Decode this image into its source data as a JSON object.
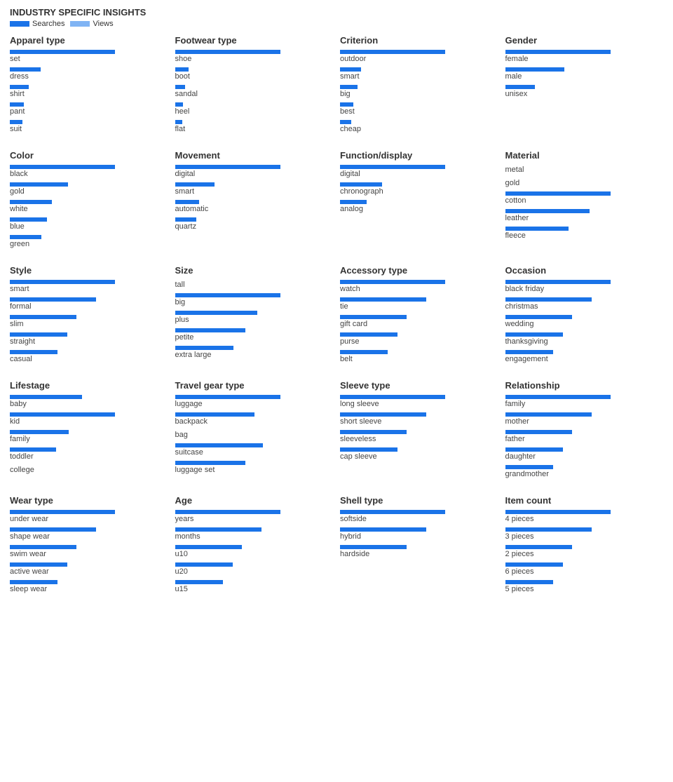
{
  "header": {
    "title": "INDUSTRY SPECIFIC INSIGHTS",
    "searches_label": "Searches",
    "views_label": "Views"
  },
  "sections": [
    {
      "id": "apparel-type",
      "title": "Apparel type",
      "items": [
        {
          "label": "set",
          "s": 120,
          "v": 0
        },
        {
          "label": "dress",
          "s": 35,
          "v": 0
        },
        {
          "label": "shirt",
          "s": 22,
          "v": 0
        },
        {
          "label": "pant",
          "s": 16,
          "v": 0
        },
        {
          "label": "suit",
          "s": 14,
          "v": 0
        }
      ]
    },
    {
      "id": "footwear-type",
      "title": "Footwear type",
      "items": [
        {
          "label": "shoe",
          "s": 170,
          "v": 0
        },
        {
          "label": "boot",
          "s": 22,
          "v": 0
        },
        {
          "label": "sandal",
          "s": 16,
          "v": 0
        },
        {
          "label": "heel",
          "s": 13,
          "v": 0
        },
        {
          "label": "flat",
          "s": 11,
          "v": 0
        }
      ]
    },
    {
      "id": "criterion",
      "title": "Criterion",
      "items": [
        {
          "label": "outdoor",
          "s": 110,
          "v": 0
        },
        {
          "label": "smart",
          "s": 22,
          "v": 0
        },
        {
          "label": "big",
          "s": 18,
          "v": 0
        },
        {
          "label": "best",
          "s": 14,
          "v": 0
        },
        {
          "label": "cheap",
          "s": 12,
          "v": 0
        }
      ]
    },
    {
      "id": "gender",
      "title": "Gender",
      "items": [
        {
          "label": "female",
          "s": 50,
          "v": 0
        },
        {
          "label": "male",
          "s": 28,
          "v": 0
        },
        {
          "label": "unisex",
          "s": 14,
          "v": 0
        }
      ]
    },
    {
      "id": "color",
      "title": "Color",
      "items": [
        {
          "label": "black",
          "s": 40,
          "v": 0
        },
        {
          "label": "gold",
          "s": 22,
          "v": 0
        },
        {
          "label": "white",
          "s": 16,
          "v": 0
        },
        {
          "label": "blue",
          "s": 14,
          "v": 0
        },
        {
          "label": "green",
          "s": 12,
          "v": 0
        }
      ]
    },
    {
      "id": "movement",
      "title": "Movement",
      "items": [
        {
          "label": "digital",
          "s": 70,
          "v": 0
        },
        {
          "label": "smart",
          "s": 26,
          "v": 0
        },
        {
          "label": "automatic",
          "s": 16,
          "v": 0
        },
        {
          "label": "quartz",
          "s": 14,
          "v": 0
        }
      ]
    },
    {
      "id": "function-display",
      "title": "Function/display",
      "items": [
        {
          "label": "digital",
          "s": 55,
          "v": 0
        },
        {
          "label": "chronograph",
          "s": 22,
          "v": 0
        },
        {
          "label": "analog",
          "s": 14,
          "v": 0
        }
      ]
    },
    {
      "id": "material",
      "title": "Material",
      "items": [
        {
          "label": "metal",
          "s": 0,
          "v": 0
        },
        {
          "label": "gold",
          "s": 0,
          "v": 0
        },
        {
          "label": "cotton",
          "s": 20,
          "v": 0
        },
        {
          "label": "leather",
          "s": 16,
          "v": 0
        },
        {
          "label": "fleece",
          "s": 12,
          "v": 0
        }
      ]
    },
    {
      "id": "style",
      "title": "Style",
      "items": [
        {
          "label": "smart",
          "s": 22,
          "v": 0
        },
        {
          "label": "formal",
          "s": 18,
          "v": 0
        },
        {
          "label": "slim",
          "s": 14,
          "v": 0
        },
        {
          "label": "straight",
          "s": 12,
          "v": 0
        },
        {
          "label": "casual",
          "s": 10,
          "v": 0
        }
      ]
    },
    {
      "id": "size",
      "title": "Size",
      "items": [
        {
          "label": "tall",
          "s": 0,
          "v": 0
        },
        {
          "label": "big",
          "s": 18,
          "v": 0
        },
        {
          "label": "plus",
          "s": 14,
          "v": 0
        },
        {
          "label": "petite",
          "s": 12,
          "v": 0
        },
        {
          "label": "extra large",
          "s": 10,
          "v": 0
        }
      ]
    },
    {
      "id": "accessory-type",
      "title": "Accessory type",
      "items": [
        {
          "label": "watch",
          "s": 22,
          "v": 0
        },
        {
          "label": "tie",
          "s": 18,
          "v": 0
        },
        {
          "label": "gift card",
          "s": 14,
          "v": 0
        },
        {
          "label": "purse",
          "s": 12,
          "v": 0
        },
        {
          "label": "belt",
          "s": 10,
          "v": 0
        }
      ]
    },
    {
      "id": "occasion",
      "title": "Occasion",
      "items": [
        {
          "label": "black friday",
          "s": 22,
          "v": 0
        },
        {
          "label": "christmas",
          "s": 18,
          "v": 0
        },
        {
          "label": "wedding",
          "s": 14,
          "v": 0
        },
        {
          "label": "thanksgiving",
          "s": 12,
          "v": 0
        },
        {
          "label": "engagement",
          "s": 10,
          "v": 0
        }
      ]
    },
    {
      "id": "lifestage",
      "title": "Lifestage",
      "items": [
        {
          "label": "baby",
          "s": 22,
          "v": 0
        },
        {
          "label": "kid",
          "s": 32,
          "v": 0
        },
        {
          "label": "family",
          "s": 18,
          "v": 0
        },
        {
          "label": "toddler",
          "s": 14,
          "v": 0
        },
        {
          "label": "college",
          "s": 0,
          "v": 0
        }
      ]
    },
    {
      "id": "travel-gear-type",
      "title": "Travel gear type",
      "items": [
        {
          "label": "luggage",
          "s": 24,
          "v": 0
        },
        {
          "label": "backpack",
          "s": 18,
          "v": 0
        },
        {
          "label": "bag",
          "s": 0,
          "v": 0
        },
        {
          "label": "suitcase",
          "s": 20,
          "v": 0
        },
        {
          "label": "luggage set",
          "s": 16,
          "v": 0
        }
      ]
    },
    {
      "id": "sleeve-type",
      "title": "Sleeve type",
      "items": [
        {
          "label": "long sleeve",
          "s": 22,
          "v": 0
        },
        {
          "label": "short sleeve",
          "s": 18,
          "v": 0
        },
        {
          "label": "sleeveless",
          "s": 14,
          "v": 0
        },
        {
          "label": "cap sleeve",
          "s": 12,
          "v": 0
        }
      ]
    },
    {
      "id": "relationship",
      "title": "Relationship",
      "items": [
        {
          "label": "family",
          "s": 22,
          "v": 0
        },
        {
          "label": "mother",
          "s": 18,
          "v": 0
        },
        {
          "label": "father",
          "s": 14,
          "v": 0
        },
        {
          "label": "daughter",
          "s": 12,
          "v": 0
        },
        {
          "label": "grandmother",
          "s": 10,
          "v": 0
        }
      ]
    },
    {
      "id": "wear-type",
      "title": "Wear type",
      "items": [
        {
          "label": "under wear",
          "s": 22,
          "v": 0
        },
        {
          "label": "shape wear",
          "s": 18,
          "v": 0
        },
        {
          "label": "swim wear",
          "s": 14,
          "v": 0
        },
        {
          "label": "active wear",
          "s": 12,
          "v": 0
        },
        {
          "label": "sleep wear",
          "s": 10,
          "v": 0
        }
      ]
    },
    {
      "id": "age",
      "title": "Age",
      "items": [
        {
          "label": "years",
          "s": 22,
          "v": 0
        },
        {
          "label": "months",
          "s": 18,
          "v": 0
        },
        {
          "label": "u10",
          "s": 14,
          "v": 0
        },
        {
          "label": "u20",
          "s": 12,
          "v": 0
        },
        {
          "label": "u15",
          "s": 10,
          "v": 0
        }
      ]
    },
    {
      "id": "shell-type",
      "title": "Shell type",
      "items": [
        {
          "label": "softside",
          "s": 22,
          "v": 0
        },
        {
          "label": "hybrid",
          "s": 18,
          "v": 0
        },
        {
          "label": "hardside",
          "s": 14,
          "v": 0
        }
      ]
    },
    {
      "id": "item-count",
      "title": "Item count",
      "items": [
        {
          "label": "4 pieces",
          "s": 22,
          "v": 0
        },
        {
          "label": "3 pieces",
          "s": 18,
          "v": 0
        },
        {
          "label": "2 pieces",
          "s": 14,
          "v": 0
        },
        {
          "label": "6 pieces",
          "s": 12,
          "v": 0
        },
        {
          "label": "5 pieces",
          "s": 10,
          "v": 0
        }
      ]
    }
  ]
}
